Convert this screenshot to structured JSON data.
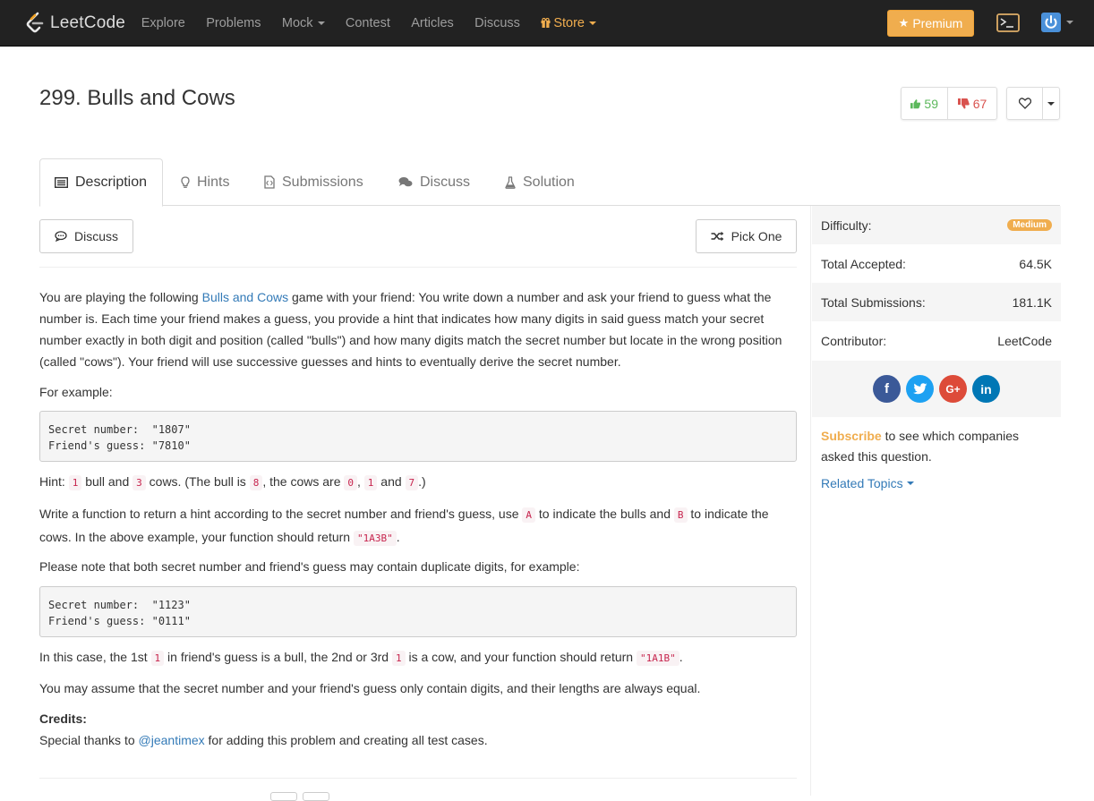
{
  "navbar": {
    "logo": "LeetCode",
    "items": [
      {
        "label": "Explore"
      },
      {
        "label": "Problems"
      },
      {
        "label": "Mock"
      },
      {
        "label": "Contest"
      },
      {
        "label": "Articles"
      },
      {
        "label": "Discuss"
      },
      {
        "label": "Store"
      }
    ],
    "premium_label": "Premium"
  },
  "problem": {
    "title": "299. Bulls and Cows",
    "likes": "59",
    "dislikes": "67"
  },
  "tabs": [
    "Description",
    "Hints",
    "Submissions",
    "Discuss",
    "Solution"
  ],
  "buttons": {
    "discuss": "Discuss",
    "pick_one": "Pick One"
  },
  "description": {
    "intro_1": "You are playing the following ",
    "intro_link": "Bulls and Cows",
    "intro_2": " game with your friend: You write down a number and ask your friend to guess what the number is. Each time your friend makes a guess, you provide a hint that indicates how many digits in said guess match your secret number exactly in both digit and position (called \"bulls\") and how many digits match the secret number but locate in the wrong position (called \"cows\"). Your friend will use successive guesses and hints to eventually derive the secret number.",
    "for_example": "For example:",
    "example1": "Secret number:  \"1807\"\nFriend's guess: \"7810\"",
    "hint": {
      "t1": "Hint: ",
      "c1": "1",
      "t2": " bull and ",
      "c2": "3",
      "t3": " cows. (The bull is ",
      "c3": "8",
      "t4": ", the cows are ",
      "c4": "0",
      "t5": ", ",
      "c5": "1",
      "t6": " and ",
      "c6": "7",
      "t7": ".)"
    },
    "write": {
      "t1": "Write a function to return a hint according to the secret number and friend's guess, use ",
      "c1": "A",
      "t2": " to indicate the bulls and ",
      "c2": "B",
      "t3": " to indicate the cows. In the above example, your function should return ",
      "c3": "\"1A3B\"",
      "t4": "."
    },
    "note": "Please note that both secret number and friend's guess may contain duplicate digits, for example:",
    "example2": "Secret number:  \"1123\"\nFriend's guess: \"0111\"",
    "case": {
      "t1": "In this case, the 1st ",
      "c1": "1",
      "t2": " in friend's guess is a bull, the 2nd or 3rd ",
      "c2": "1",
      "t3": " is a cow, and your function should return ",
      "c3": "\"1A1B\"",
      "t4": "."
    },
    "assume": "You may assume that the secret number and your friend's guess only contain digits, and their lengths are always equal.",
    "credits_label": "Credits:",
    "thanks_1": "Special thanks to ",
    "thanks_link": "@jeantimex",
    "thanks_2": " for adding this problem and creating all test cases."
  },
  "sidebar": {
    "difficulty_label": "Difficulty:",
    "difficulty_value": "Medium",
    "accepted_label": "Total Accepted:",
    "accepted_value": "64.5K",
    "submissions_label": "Total Submissions:",
    "submissions_value": "181.1K",
    "contributor_label": "Contributor:",
    "contributor_value": "LeetCode",
    "subscribe_link": "Subscribe",
    "subscribe_text": " to see which companies asked this question.",
    "related_topics": "Related Topics",
    "social": [
      {
        "name": "facebook",
        "glyph": "f",
        "color": "#3b5998"
      },
      {
        "name": "twitter",
        "glyph": "t",
        "color": "#1da1f2"
      },
      {
        "name": "google-plus",
        "glyph": "G+",
        "color": "#dd4b39"
      },
      {
        "name": "linkedin",
        "glyph": "in",
        "color": "#0077b5"
      }
    ]
  },
  "colors": {
    "navbar_bg": "#222222",
    "accent_orange": "#f0ad4e",
    "link_blue": "#337ab7",
    "like_green": "#5cb85c",
    "dislike_red": "#d9534f"
  }
}
